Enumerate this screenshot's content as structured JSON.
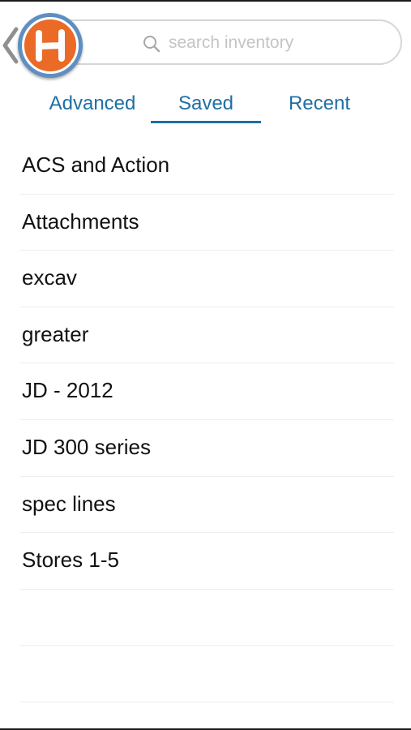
{
  "header": {
    "logo_letter": "H",
    "search": {
      "placeholder": "search inventory",
      "value": ""
    }
  },
  "tabs": [
    {
      "label": "Advanced",
      "active": false
    },
    {
      "label": "Saved",
      "active": true
    },
    {
      "label": "Recent",
      "active": false
    }
  ],
  "saved_searches": [
    {
      "label": "ACS and Action"
    },
    {
      "label": "Attachments"
    },
    {
      "label": "excav"
    },
    {
      "label": "greater"
    },
    {
      "label": "JD - 2012"
    },
    {
      "label": "JD 300 series"
    },
    {
      "label": "spec lines"
    },
    {
      "label": "Stores 1-5"
    }
  ],
  "colors": {
    "accent": "#1e6fa5",
    "logo_orange": "#eb6a26",
    "logo_ring": "#5e8fc2",
    "placeholder": "#c4c4c4"
  },
  "icons": {
    "back": "chevron-left-icon",
    "search": "magnifier-icon",
    "logo": "h-logo-icon"
  }
}
